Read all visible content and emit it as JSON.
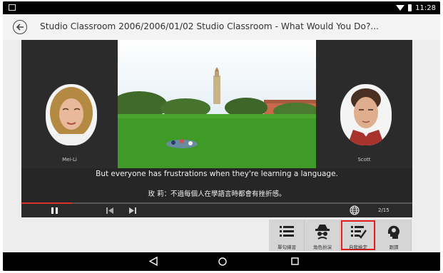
{
  "status_bar": {
    "time": "11:28"
  },
  "header": {
    "title": "Studio Classroom 2006/2006/01/02 Studio Classroom - What Would You Do?..."
  },
  "player": {
    "speakers": {
      "left": "Mei-Li",
      "right": "Scott"
    },
    "subtitle_en": "But everyone has frustrations when they're learning a language.",
    "subtitle_zh": "玫 莉：不過每個人在學語言時都會有挫折感。",
    "page_count": "2/15",
    "progress_fraction": 0.13
  },
  "toolbar": {
    "items": [
      {
        "label": "單句練習",
        "icon": "list-icon"
      },
      {
        "label": "角色扮演",
        "icon": "spy-icon"
      },
      {
        "label": "自我檢定",
        "icon": "checklist-icon",
        "selected": true
      },
      {
        "label": "跟讀",
        "icon": "head-speak-icon"
      }
    ]
  },
  "colors": {
    "accent": "#e41e1e",
    "progress": "#d9302c"
  }
}
